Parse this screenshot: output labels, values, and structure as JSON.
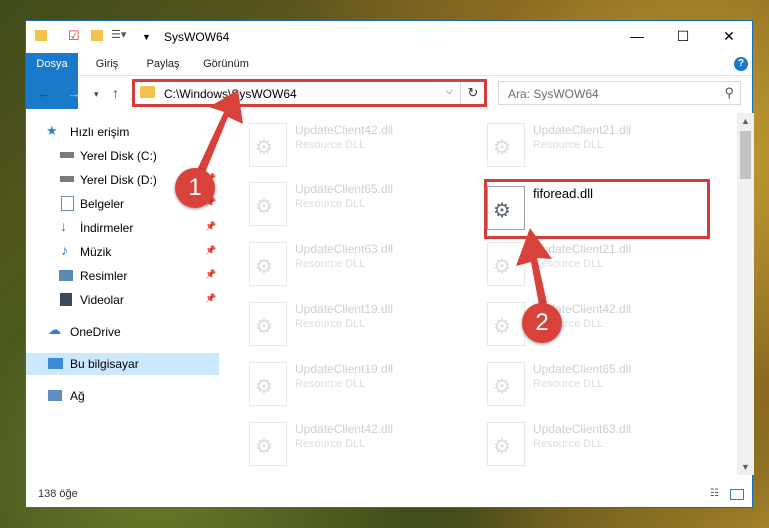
{
  "window": {
    "title": "SysWOW64"
  },
  "ribbon": {
    "tabs": [
      "Dosya",
      "Giriş",
      "Paylaş",
      "Görünüm"
    ],
    "help": "?"
  },
  "address": {
    "path": "C:\\Windows\\SysWOW64"
  },
  "search": {
    "placeholder": "Ara: SysWOW64"
  },
  "sidebar": {
    "items": [
      {
        "label": "Hızlı erişim",
        "icon": "star-icon",
        "pinned": false
      },
      {
        "label": "Yerel Disk (C:)",
        "icon": "drive-icon",
        "pinned": false
      },
      {
        "label": "Yerel Disk (D:)",
        "icon": "drive-icon",
        "pinned": false
      },
      {
        "label": "Belgeler",
        "icon": "documents-icon",
        "pinned": true
      },
      {
        "label": "İndirmeler",
        "icon": "download-icon",
        "pinned": true
      },
      {
        "label": "Müzik",
        "icon": "music-icon",
        "pinned": true
      },
      {
        "label": "Resimler",
        "icon": "pictures-icon",
        "pinned": true
      },
      {
        "label": "Videolar",
        "icon": "video-icon",
        "pinned": true
      },
      {
        "label": "OneDrive",
        "icon": "cloud-icon",
        "pinned": false
      },
      {
        "label": "Bu bilgisayar",
        "icon": "computer-icon",
        "pinned": false
      },
      {
        "label": "Ağ",
        "icon": "network-icon",
        "pinned": false
      }
    ]
  },
  "files": {
    "left": [
      {
        "name": "UpdateClient42.dll",
        "desc": "Resource DLL"
      },
      {
        "name": "UpdateClient65.dll",
        "desc": "Resource DLL"
      },
      {
        "name": "UpdateClient63.dll",
        "desc": "Resource DLL"
      },
      {
        "name": "UpdateClient19.dll",
        "desc": "Resource DLL"
      },
      {
        "name": "UpdateClient19.dll",
        "desc": "Resource DLL"
      },
      {
        "name": "UpdateClient42.dll",
        "desc": "Resource DLL"
      }
    ],
    "right": [
      {
        "name": "UpdateClient21.dll",
        "desc": "Resource DLL"
      },
      {
        "name": "fiforead.dll",
        "desc": ""
      },
      {
        "name": "UpdateClient21.dll",
        "desc": "Resource DLL"
      },
      {
        "name": "UpdateClient42.dll",
        "desc": "Resource DLL"
      },
      {
        "name": "UpdateClient65.dll",
        "desc": "Resource DLL"
      },
      {
        "name": "UpdateClient63.dll",
        "desc": "Resource DLL"
      }
    ]
  },
  "status": {
    "count": "138 öğe"
  },
  "annotations": {
    "step1": "1",
    "step2": "2"
  },
  "colors": {
    "accent": "#1979ca",
    "highlight": "#d43d3d",
    "selection": "#cce8ff"
  }
}
